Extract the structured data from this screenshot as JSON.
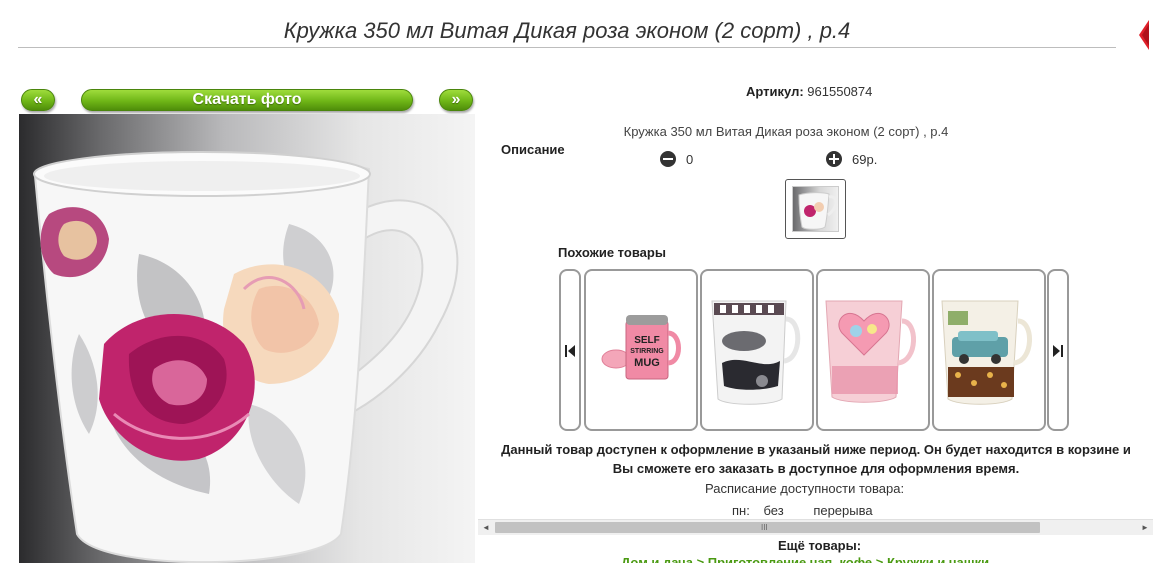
{
  "product": {
    "title": "Кружка 350 мл Витая Дикая роза эконом (2 сорт) , р.4"
  },
  "gallery": {
    "prev_label": "«",
    "download_label": "Скачать фото",
    "next_label": "»"
  },
  "details": {
    "article_label": "Артикул:",
    "article_value": "961550874",
    "description_label": "Описание",
    "description_text": "Кружка 350 мл Витая Дикая роза эконом (2 сорт) , р.4",
    "quantity_value": "0",
    "price_value": "69р."
  },
  "similar": {
    "label": "Похожие товары",
    "items": [
      {
        "name": "self-stirring-mug",
        "image_text_line1": "SELF",
        "image_text_line2": "STIRRING",
        "image_text_line3": "MUG"
      },
      {
        "name": "fashion-print-mug"
      },
      {
        "name": "pink-heart-mug"
      },
      {
        "name": "retro-car-mug"
      }
    ]
  },
  "availability": {
    "notice": "Данный товар доступен к оформление в указаный ниже период. Он будет находится в корзине и Вы сможете его заказать в доступное для оформления время.",
    "schedule_title": "Расписание доступности товара:",
    "schedule_day": "пн:",
    "schedule_word1": "без",
    "schedule_word2": "перерыва"
  },
  "scrollbar": {
    "left_arrow": "◄",
    "right_arrow": "►",
    "grip": "III"
  },
  "more": {
    "title": "Ещё товары:",
    "links": "Дом и дача > Приготовление чая, кофе > Кружки и чашки"
  },
  "colors": {
    "button_green": "#6fb617",
    "link_green": "#4a9a12",
    "close_red": "#e0202a"
  }
}
